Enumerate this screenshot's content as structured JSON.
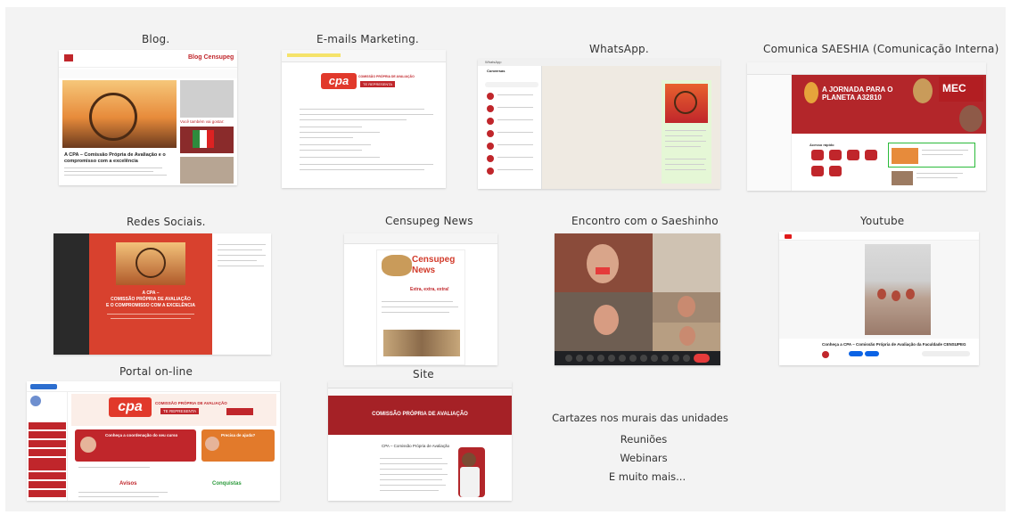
{
  "labels": {
    "blog": "Blog.",
    "emails": "E-mails Marketing.",
    "whatsapp": "WhatsApp.",
    "comunica": "Comunica SAESHIA (Comunicação Interna)",
    "redes": "Redes Sociais.",
    "news": "Censupeg News",
    "encontro": "Encontro com o Saeshinho",
    "youtube": "Youtube",
    "portal": "Portal on-line",
    "site": "Site"
  },
  "extras": [
    "Cartazes nos murais das unidades",
    "Reuniões",
    "Webinars",
    "E muito mais..."
  ],
  "blog": {
    "brand": "Blog Censupeg",
    "headline": "A CPA – Comissão Própria de Avaliação e o compromisso com a excelência",
    "side_label": "Você também vai gostar:"
  },
  "email": {
    "logo": "cpa",
    "tag": "COMISSÃO PRÓPRIA DE AVALIAÇÃO",
    "badge": "TE REPRESENTA"
  },
  "whatsapp": {
    "app": "WhatsApp",
    "tab": "Conversas"
  },
  "comunica": {
    "headline": "A JORNADA PARA O PLANETA A32810",
    "mec": "MEC",
    "section": "Acesso rápido"
  },
  "redes": {
    "headline1": "A CPA –",
    "headline2": "COMISSÃO PRÓPRIA DE AVALIAÇÃO",
    "headline3": "E O COMPROMISSO COM A EXCELÊNCIA"
  },
  "news": {
    "title1": "Censupeg",
    "title2": "News",
    "extra": "Extra, extra, extra!"
  },
  "youtube": {
    "title": "Conheça a CPA – Comissão Própria de Avaliação da Faculdade CENSUPEG"
  },
  "portal": {
    "logo": "cpa",
    "tag": "COMISSÃO PRÓPRIA DE AVALIAÇÃO",
    "badge": "TE REPRESENTA",
    "card1": "Conheça a coordenação do seu curso",
    "card2": "Precisa de ajuda?",
    "col1": "Avisos",
    "col2": "Conquistas"
  },
  "site": {
    "title": "COMISSÃO PRÓPRIA DE AVALIAÇÃO",
    "sub": "CPA – Comissão Própria de Avaliação"
  },
  "colors": {
    "brand_red": "#c0262b",
    "background": "#f3f3f3",
    "whatsapp_green": "#e5f7d6"
  }
}
